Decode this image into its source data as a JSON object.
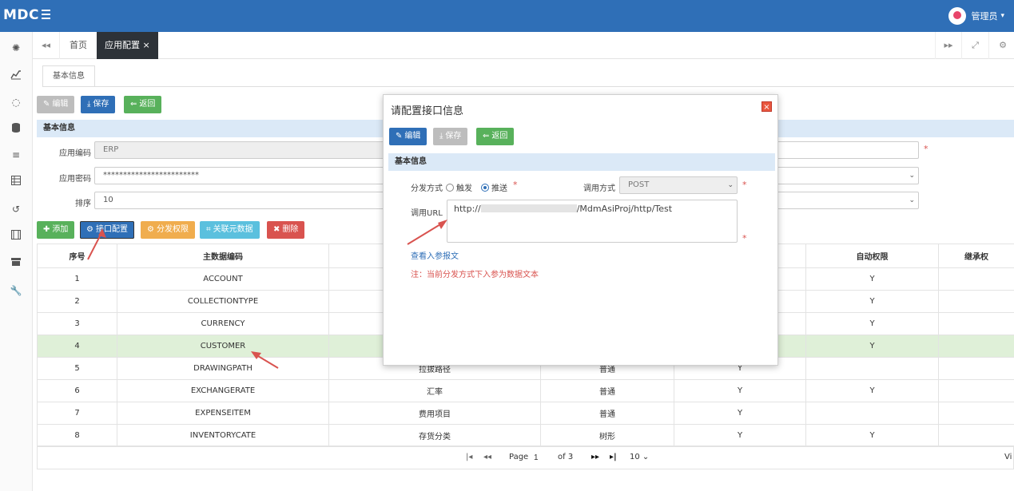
{
  "header": {
    "logo": "MDC",
    "user_name": "管理员",
    "user_caret": "▾"
  },
  "tabs": {
    "home": "首页",
    "active": "应用配置",
    "close_glyph": "×"
  },
  "subtab": "基本信息",
  "toolbar": {
    "edit": "编辑",
    "save": "保存",
    "back": "返回"
  },
  "basic_section": "基本信息",
  "form": {
    "app_code_label": "应用编码",
    "app_code_value": "ERP",
    "app_password_label": "应用密码",
    "app_password_value": "************************",
    "order_label": "排序",
    "order_value": "10",
    "required": "*"
  },
  "grid_toolbar": {
    "add": "添加",
    "interface_config": "接口配置",
    "dispatch_perm": "分发权限",
    "link_metadata": "关联元数据",
    "delete": "删除"
  },
  "table": {
    "headers": [
      "序号",
      "主数据编码",
      "",
      "",
      "",
      "自动权限",
      "继承权"
    ],
    "rows": [
      [
        "1",
        "ACCOUNT",
        "",
        "",
        "",
        "Y",
        ""
      ],
      [
        "2",
        "COLLECTIONTYPE",
        "",
        "",
        "",
        "Y",
        ""
      ],
      [
        "3",
        "CURRENCY",
        "",
        "",
        "",
        "Y",
        ""
      ],
      [
        "4",
        "CUSTOMER",
        "",
        "",
        "",
        "Y",
        ""
      ],
      [
        "5",
        "DRAWINGPATH",
        "拉拔路径",
        "普通",
        "Y",
        "",
        ""
      ],
      [
        "6",
        "EXCHANGERATE",
        "汇率",
        "普通",
        "Y",
        "Y",
        ""
      ],
      [
        "7",
        "EXPENSEITEM",
        "费用项目",
        "普通",
        "Y",
        "",
        ""
      ],
      [
        "8",
        "INVENTORYCATE",
        "存货分类",
        "树形",
        "Y",
        "Y",
        ""
      ]
    ],
    "selected_row": 3
  },
  "pager": {
    "page_label": "Page",
    "page_value": "1",
    "of_label": "of 3",
    "page_size": "10",
    "view_text": "Vi"
  },
  "modal": {
    "title": "请配置接口信息",
    "close": "×",
    "edit": "编辑",
    "save": "保存",
    "back": "返回",
    "section": "基本信息",
    "dispatch_label": "分发方式",
    "opt_trigger": "触发",
    "opt_push": "推送",
    "call_method_label": "调用方式",
    "call_method_value": "POST",
    "url_label": "调用URL",
    "url_value_prefix": "http://",
    "url_value_suffix": "/MdmAsiProj/http/Test",
    "view_params_link": "查看入参报文",
    "note": "注：当前分发方式下入参为数据文本"
  },
  "colors": {
    "brand": "#2f6fb7",
    "sidebar_bg": "#fafafa",
    "selected_row": "#dff0d8",
    "danger": "#d9534f",
    "arrow": "#d9534f"
  }
}
